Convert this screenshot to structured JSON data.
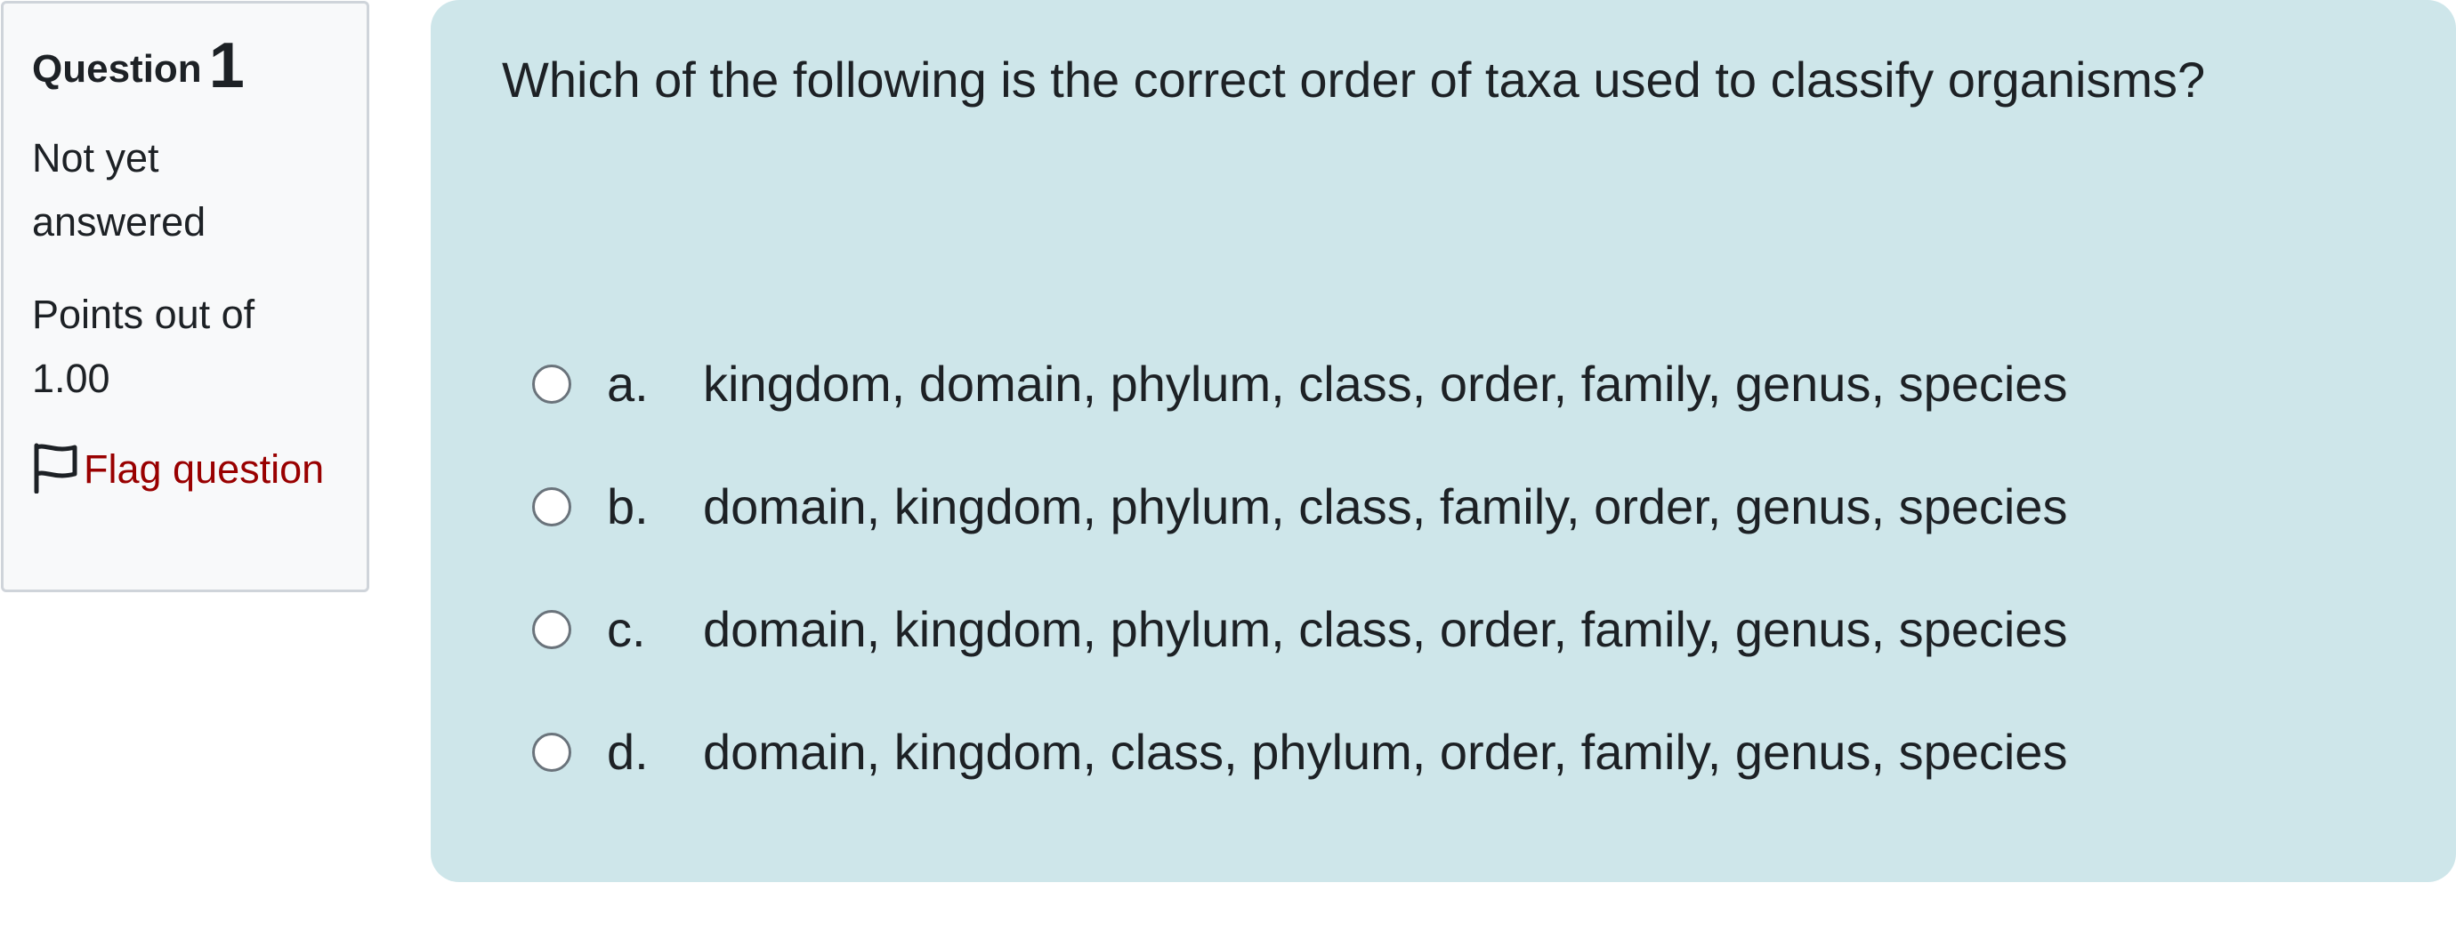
{
  "info": {
    "question_label": "Question",
    "question_number": "1",
    "state": "Not yet answered",
    "grade": "Points out of 1.00",
    "flag_label": "Flag question"
  },
  "question": {
    "text": "Which of the following is the correct order of taxa used to classify organisms?",
    "answers": [
      {
        "letter": "a.",
        "text": "kingdom, domain, phylum, class, order, family, genus, species",
        "selected": false
      },
      {
        "letter": "b.",
        "text": "domain, kingdom, phylum, class, family, order, genus, species",
        "selected": false
      },
      {
        "letter": "c.",
        "text": "domain, kingdom, phylum, class, order, family, genus, species",
        "selected": false
      },
      {
        "letter": "d.",
        "text": "domain, kingdom, class, phylum, order, family, genus, species",
        "selected": false
      }
    ]
  },
  "colors": {
    "content_background": "#cee6ea",
    "info_background": "#f8f9fa",
    "flag_link": "#990000",
    "text": "#1d2125"
  },
  "icons": {
    "flag": "flag-outline-icon"
  }
}
